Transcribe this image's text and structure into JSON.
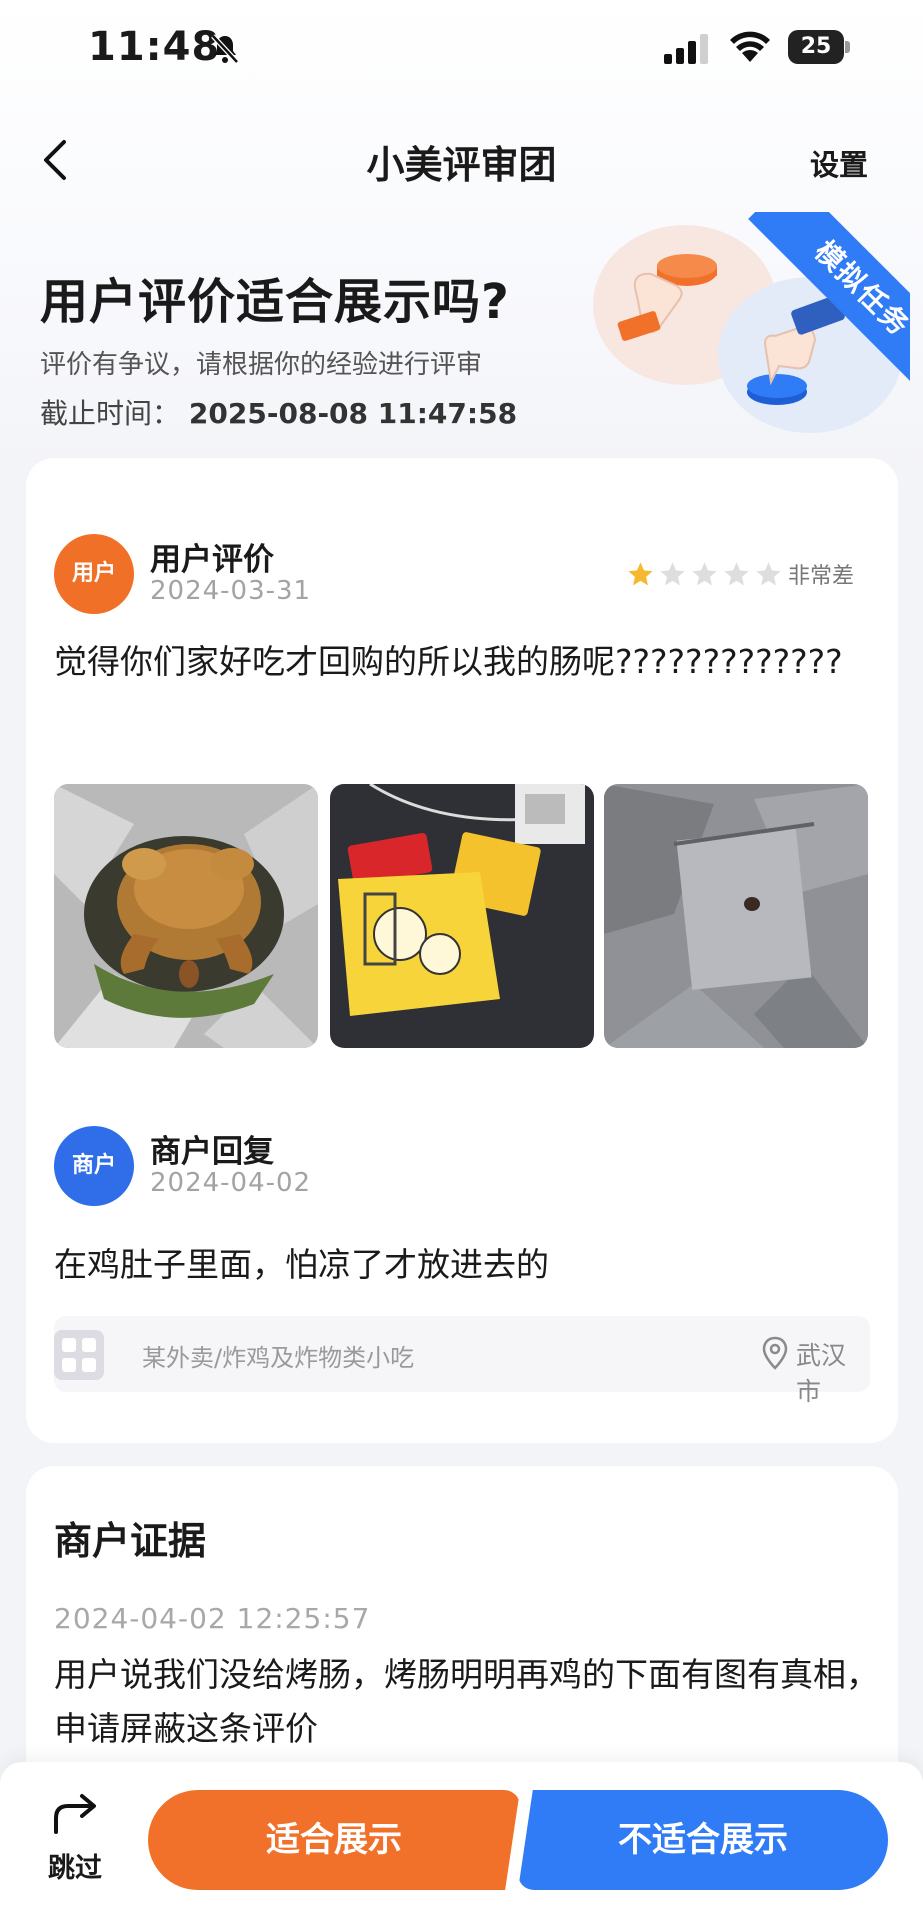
{
  "status_bar": {
    "time": "11:48",
    "battery": "25"
  },
  "nav": {
    "title": "小美评审团",
    "settings": "设置"
  },
  "hero": {
    "title": "用户评价适合展示吗?",
    "subtitle": "评价有争议，请根据你的经验进行评审",
    "deadline_label": "截止时间：",
    "deadline_value": "2025-08-08 11:47:58",
    "ribbon": "模拟任务"
  },
  "user_review": {
    "avatar": "用户",
    "name": "用户评价",
    "date": "2024-03-31",
    "stars_filled": 1,
    "stars_total": 5,
    "rating_label": "非常差",
    "text": "觉得你们家好吃才回购的所以我的肠呢?????????????"
  },
  "merchant_reply": {
    "avatar": "商户",
    "name": "商户回复",
    "date": "2024-04-02",
    "text": "在鸡肚子里面，怕凉了才放进去的"
  },
  "shop": {
    "category": "某外卖/炸鸡及炸物类小吃",
    "location": "武汉市"
  },
  "evidence": {
    "title": "商户证据",
    "time": "2024-04-02 12:25:57",
    "text": "用户说我们没给烤肠，烤肠明明再鸡的下面有图有真相，申请屏蔽这条评价"
  },
  "actions": {
    "skip": "跳过",
    "suitable": "适合展示",
    "unsuitable": "不适合展示"
  },
  "colors": {
    "orange": "#f2712a",
    "blue": "#2f7cf6",
    "star": "#f5b82e"
  }
}
